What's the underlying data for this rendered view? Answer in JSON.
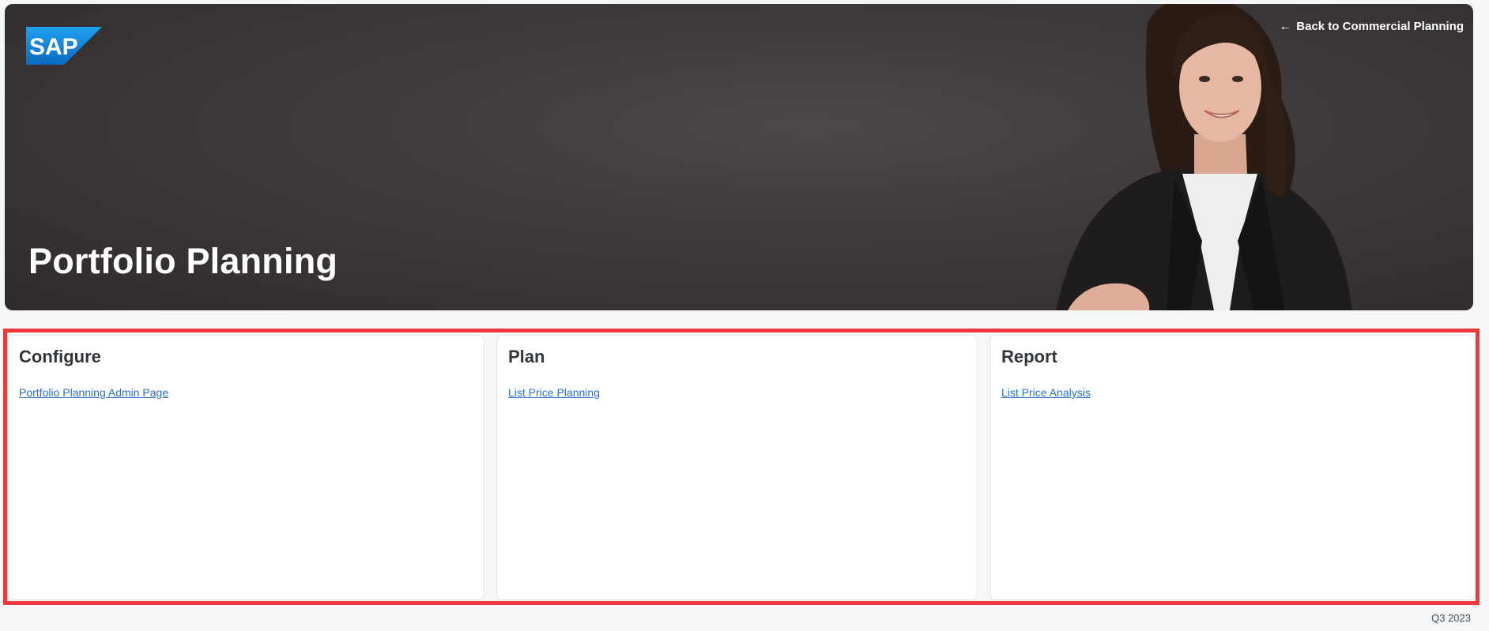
{
  "brand": {
    "logo_text": "SAP",
    "logo_color": "#1c8ad8"
  },
  "header": {
    "back_link_label": "Back to Commercial Planning",
    "back_icon": "arrow-left-icon",
    "title": "Portfolio Planning"
  },
  "cards": [
    {
      "heading": "Configure",
      "link": "Portfolio Planning Admin Page"
    },
    {
      "heading": "Plan",
      "link": "List Price Planning"
    },
    {
      "heading": "Report",
      "link": "List Price Analysis"
    }
  ],
  "footer": {
    "version": "Q3 2023"
  },
  "colors": {
    "link": "#2a6fc7",
    "highlight": "#f0383b",
    "hero_bg": "#3e393a"
  }
}
